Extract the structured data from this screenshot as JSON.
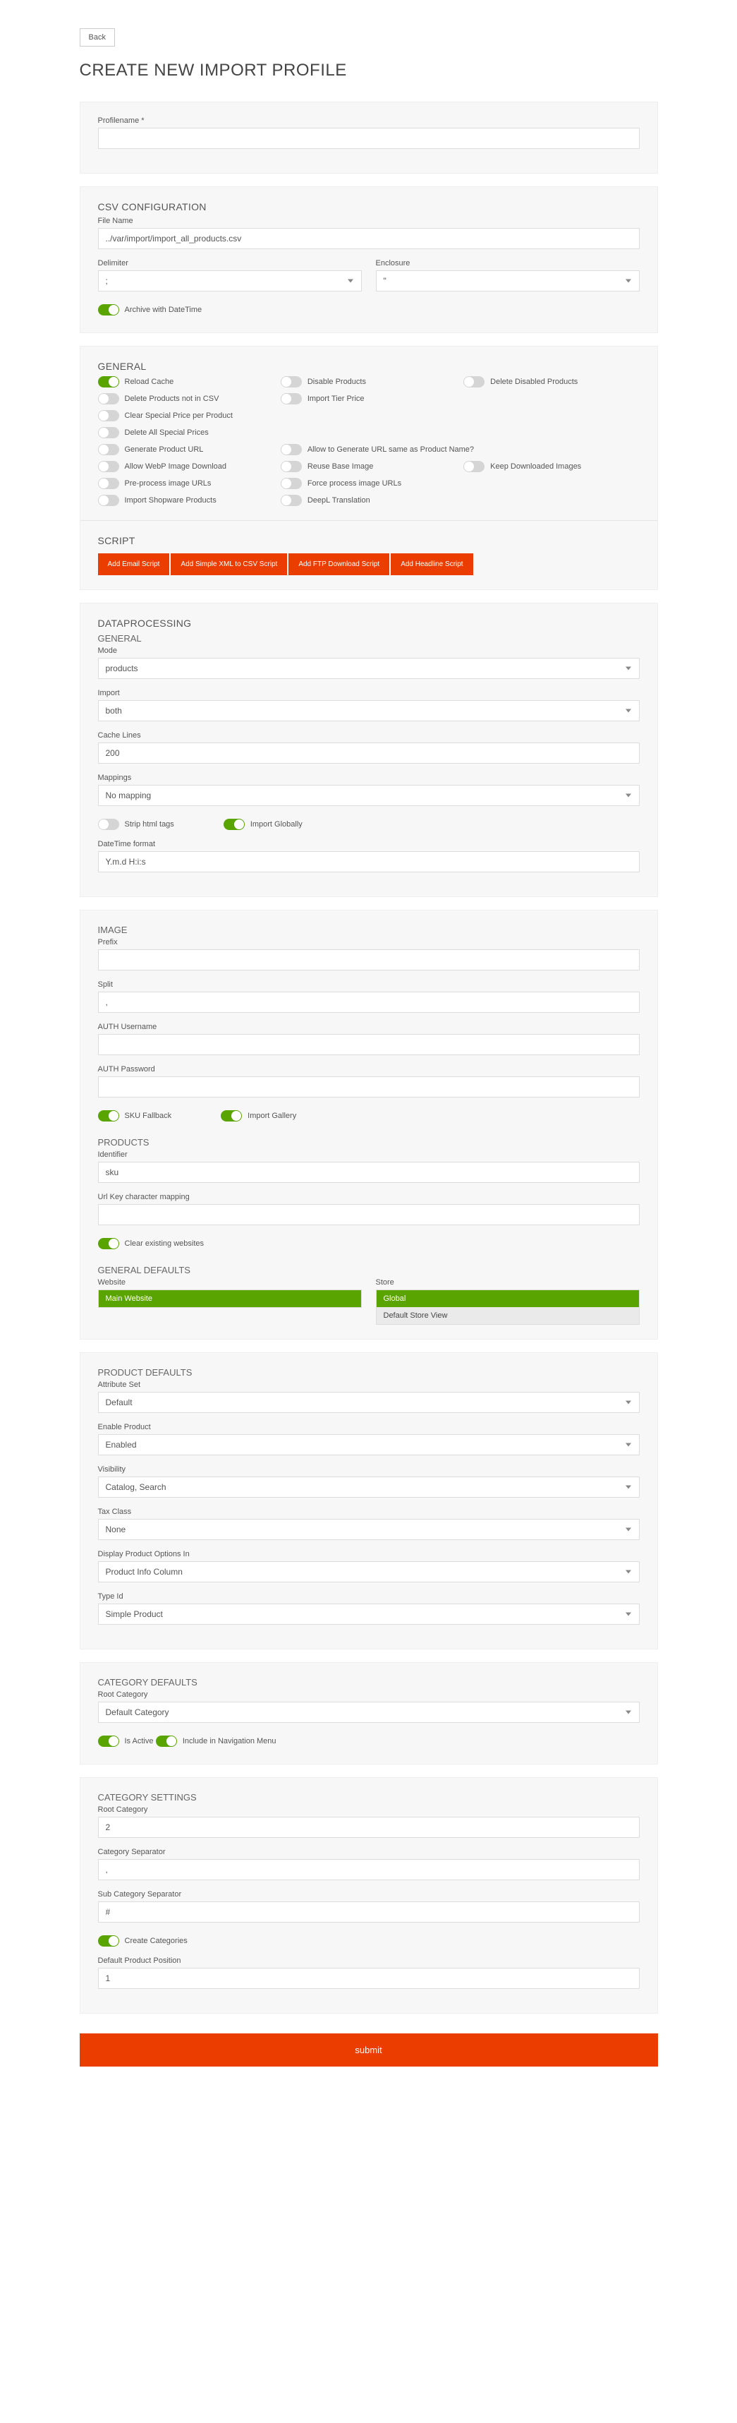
{
  "back": "Back",
  "title": "CREATE NEW IMPORT PROFILE",
  "profile": {
    "label": "Profilename *",
    "value": ""
  },
  "csv": {
    "heading": "CSV CONFIGURATION",
    "file_label": "File Name",
    "file_value": "../var/import/import_all_products.csv",
    "delimiter_label": "Delimiter",
    "delimiter_value": ";",
    "enclosure_label": "Enclosure",
    "enclosure_value": "\"",
    "archive_label": "Archive with DateTime"
  },
  "general": {
    "heading": "GENERAL",
    "toggles": {
      "reload_cache": "Reload Cache",
      "disable_products": "Disable Products",
      "delete_disabled": "Delete Disabled Products",
      "delete_not_in_csv": "Delete Products not in CSV",
      "import_tier_price": "Import Tier Price",
      "clear_special": "Clear Special Price per Product",
      "delete_all_special": "Delete All Special Prices",
      "generate_url": "Generate Product URL",
      "allow_generate_url": "Allow to Generate URL same as Product Name?",
      "allow_webp": "Allow WebP Image Download",
      "reuse_base": "Reuse Base Image",
      "keep_downloaded": "Keep Downloaded Images",
      "preprocess": "Pre-process image URLs",
      "force_process": "Force process image URLs",
      "import_shopware": "Import Shopware Products",
      "deepl": "DeepL Translation"
    },
    "script_heading": "SCRIPT",
    "scripts": {
      "email": "Add Email Script",
      "xml": "Add Simple XML to CSV Script",
      "ftp": "Add FTP Download Script",
      "headline": "Add Headline Script"
    }
  },
  "dp": {
    "heading": "DATAPROCESSING",
    "general_heading": "GENERAL",
    "mode_label": "Mode",
    "mode_value": "products",
    "import_label": "Import",
    "import_value": "both",
    "cache_label": "Cache Lines",
    "cache_value": "200",
    "mappings_label": "Mappings",
    "mappings_value": "No mapping",
    "strip_label": "Strip html tags",
    "import_globally_label": "Import Globally",
    "dt_label": "DateTime format",
    "dt_value": "Y.m.d H:i:s",
    "image_heading": "IMAGE",
    "prefix_label": "Prefix",
    "prefix_value": "",
    "split_label": "Split",
    "split_value": ",",
    "auth_user_label": "AUTH Username",
    "auth_user_value": "",
    "auth_pass_label": "AUTH Password",
    "auth_pass_value": "",
    "sku_fallback_label": "SKU Fallback",
    "import_gallery_label": "Import Gallery",
    "products_heading": "PRODUCTS",
    "identifier_label": "Identifier",
    "identifier_value": "sku",
    "url_key_label": "Url Key character mapping",
    "url_key_value": "",
    "clear_websites_label": "Clear existing websites",
    "gen_defaults_heading": "GENERAL DEFAULTS",
    "website_label": "Website",
    "website_options": [
      "Main Website"
    ],
    "store_label": "Store",
    "store_options": [
      "Global",
      "Default Store View"
    ],
    "prod_defaults_heading": "PRODUCT DEFAULTS",
    "attr_set_label": "Attribute Set",
    "attr_set_value": "Default",
    "enable_label": "Enable Product",
    "enable_value": "Enabled",
    "visibility_label": "Visibility",
    "visibility_value": "Catalog, Search",
    "tax_label": "Tax Class",
    "tax_value": "None",
    "display_opts_label": "Display Product Options In",
    "display_opts_value": "Product Info Column",
    "type_id_label": "Type Id",
    "type_id_value": "Simple Product",
    "cat_defaults_heading": "CATEGORY DEFAULTS",
    "root_cat_label": "Root Category",
    "root_cat_value": "Default Category",
    "is_active_label": "Is Active",
    "include_nav_label": "Include in Navigation Menu",
    "cat_settings_heading": "CATEGORY SETTINGS",
    "root_cat2_label": "Root Category",
    "root_cat2_value": "2",
    "cat_sep_label": "Category Separator",
    "cat_sep_value": ",",
    "sub_cat_sep_label": "Sub Category Separator",
    "sub_cat_sep_value": "#",
    "create_cats_label": "Create Categories",
    "default_pos_label": "Default Product Position",
    "default_pos_value": "1"
  },
  "submit": "submit"
}
